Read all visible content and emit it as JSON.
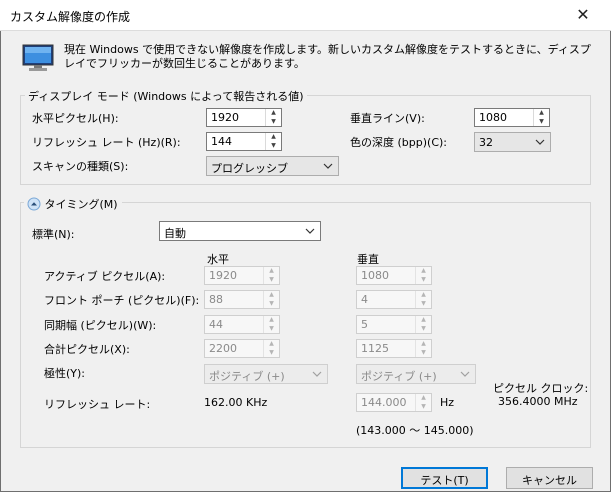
{
  "window": {
    "title": "カスタム解像度の作成",
    "close_glyph": "✕"
  },
  "description": "現在 Windows で使用できない解像度を作成します。新しいカスタム解像度をテストするときに、ディスプレイでフリッカーが数回生じることがあります。",
  "display_mode": {
    "legend": "ディスプレイ モード (Windows によって報告される値)",
    "h_pixels": {
      "label": "水平ピクセル(H):",
      "value": "1920"
    },
    "v_lines": {
      "label": "垂直ライン(V):",
      "value": "1080"
    },
    "refresh": {
      "label": "リフレッシュ レート (Hz)(R):",
      "value": "144"
    },
    "color_depth": {
      "label": "色の深度 (bpp)(C):",
      "value": "32"
    },
    "scan_type": {
      "label": "スキャンの種類(S):",
      "value": "プログレッシブ"
    }
  },
  "timing": {
    "toggle_label": "タイミング(M)",
    "standard_label": "標準(N):",
    "standard_value": "自動",
    "col_horizontal": "水平",
    "col_vertical": "垂直",
    "rows": [
      {
        "label": "アクティブ ピクセル(A):",
        "h": "1920",
        "v": "1080"
      },
      {
        "label": "フロント ポーチ (ピクセル)(F):",
        "h": "88",
        "v": "4"
      },
      {
        "label": "同期幅 (ピクセル)(W):",
        "h": "44",
        "v": "5"
      },
      {
        "label": "合計ピクセル(X):",
        "h": "2200",
        "v": "1125"
      }
    ],
    "polarity_label": "極性(Y):",
    "polarity_h": "ポジティブ (+)",
    "polarity_v": "ポジティブ (+)",
    "refresh_label": "リフレッシュ レート:",
    "refresh_khz": "162.00 KHz",
    "refresh_hz_value": "144.000",
    "hz_unit": "Hz",
    "hz_range": "(143.000 ～ 145.000)",
    "pixel_clock_label": "ピクセル クロック:",
    "pixel_clock_value": "356.4000 MHz"
  },
  "buttons": {
    "test": "テスト(T)",
    "cancel": "キャンセル"
  },
  "colors": {
    "accent": "#0078d7",
    "toggle_icon": "#cfe3f7"
  }
}
